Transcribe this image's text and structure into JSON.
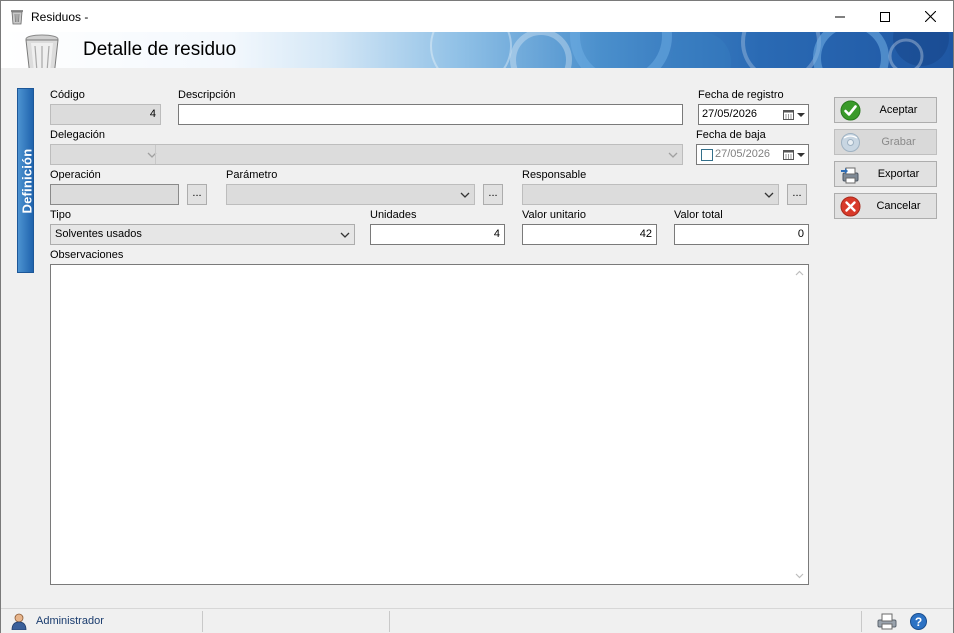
{
  "window": {
    "title": "Residuos -"
  },
  "header": {
    "title": "Detalle de residuo"
  },
  "side_tab": {
    "label": "Definición"
  },
  "form": {
    "codigo": {
      "label": "Código",
      "value": "4"
    },
    "descripcion": {
      "label": "Descripción",
      "value": ""
    },
    "fecha_registro": {
      "label": "Fecha de registro",
      "value": "27/05/2026"
    },
    "delegacion": {
      "label": "Delegación",
      "value": ""
    },
    "fecha_baja": {
      "label": "Fecha de baja",
      "value": "27/05/2026",
      "checked": false
    },
    "operacion": {
      "label": "Operación",
      "value": "",
      "button": "..."
    },
    "parametro": {
      "label": "Parámetro",
      "value": "",
      "button": "..."
    },
    "responsable": {
      "label": "Responsable",
      "value": "",
      "button": "..."
    },
    "tipo": {
      "label": "Tipo",
      "value": "Solventes usados"
    },
    "unidades": {
      "label": "Unidades",
      "value": "4"
    },
    "valor_unitario": {
      "label": "Valor unitario",
      "value": "42"
    },
    "valor_total": {
      "label": "Valor total",
      "value": "0"
    },
    "observaciones": {
      "label": "Observaciones",
      "value": ""
    }
  },
  "actions": {
    "aceptar": {
      "label": "Aceptar",
      "icon": "check-icon",
      "enabled": true
    },
    "grabar": {
      "label": "Grabar",
      "icon": "disk-icon",
      "enabled": false
    },
    "exportar": {
      "label": "Exportar",
      "icon": "export-icon",
      "enabled": true
    },
    "cancelar": {
      "label": "Cancelar",
      "icon": "cancel-icon",
      "enabled": true
    }
  },
  "status": {
    "user": "Administrador"
  },
  "colors": {
    "accent": "#1f63ad",
    "ok": "#3a9a2a",
    "cancel": "#d83a2a"
  }
}
